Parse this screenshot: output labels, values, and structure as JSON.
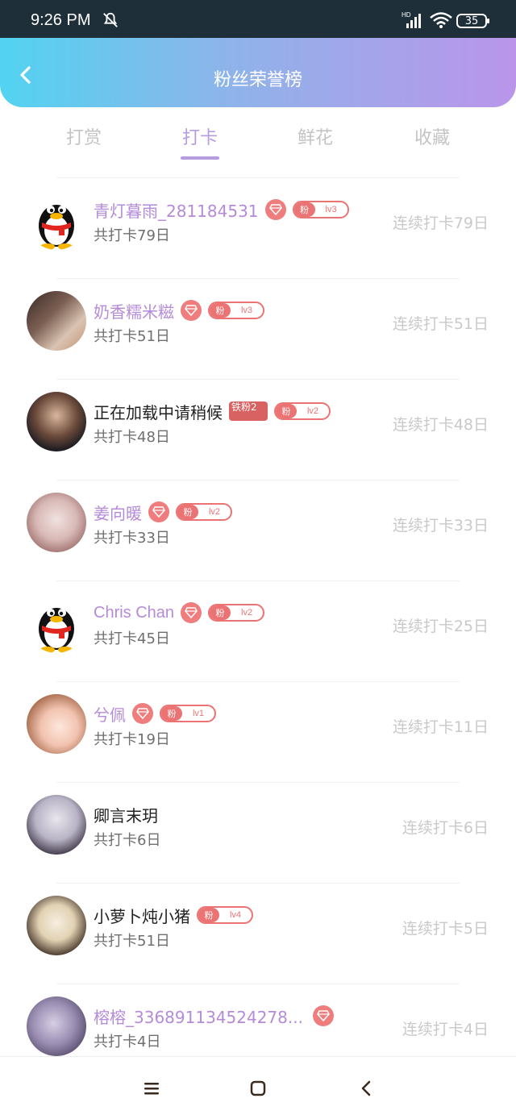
{
  "status": {
    "time": "9:26 PM",
    "battery": "35"
  },
  "header": {
    "title": "粉丝荣誉榜"
  },
  "tabs": [
    {
      "label": "打赏",
      "active": false
    },
    {
      "label": "打卡",
      "active": true
    },
    {
      "label": "鲜花",
      "active": false
    },
    {
      "label": "收藏",
      "active": false
    }
  ],
  "rows": [
    {
      "name": "青灯暮雨_281184531",
      "name_color": "purple",
      "gem": true,
      "fan_label": "粉",
      "level": "lv3",
      "total": "共打卡79日",
      "streak": "连续打卡79日",
      "avatar": "qq-penguin"
    },
    {
      "name": "奶香糯米糍",
      "name_color": "purple",
      "gem": true,
      "fan_label": "粉",
      "level": "lv3",
      "total": "共打卡51日",
      "streak": "连续打卡51日",
      "avatar": "photo"
    },
    {
      "name": "正在加载中请稍候",
      "name_color": "dark",
      "iron_label": "铁粉2",
      "fan_label": "粉",
      "level": "lv2",
      "total": "共打卡48日",
      "streak": "连续打卡48日",
      "avatar": "anime"
    },
    {
      "name": "姜向暖",
      "name_color": "purple",
      "gem": true,
      "fan_label": "粉",
      "level": "lv2",
      "total": "共打卡33日",
      "streak": "连续打卡33日",
      "avatar": "photo"
    },
    {
      "name": "Chris Chan",
      "name_color": "purple",
      "gem": true,
      "fan_label": "粉",
      "level": "lv2",
      "total": "共打卡45日",
      "streak": "连续打卡25日",
      "avatar": "qq-penguin"
    },
    {
      "name": "兮佩",
      "name_color": "purple",
      "gem": true,
      "fan_label": "粉",
      "level": "lv1",
      "total": "共打卡19日",
      "streak": "连续打卡11日",
      "avatar": "anime"
    },
    {
      "name": "卿言末玥",
      "name_color": "dark",
      "total": "共打卡6日",
      "streak": "连续打卡6日",
      "avatar": "photo"
    },
    {
      "name": "小萝卜炖小猪",
      "name_color": "dark",
      "fan_label": "粉",
      "level": "lv4",
      "total": "共打卡51日",
      "streak": "连续打卡5日",
      "avatar": "photo"
    },
    {
      "name": "榕榕_336891134524278...",
      "name_color": "purple",
      "gem": true,
      "total": "共打卡4日",
      "streak": "连续打卡4日",
      "avatar": "photo"
    }
  ],
  "colors": {
    "accent": "#b79be0",
    "badge": "#ec7373",
    "header_start": "#52d3f1",
    "header_end": "#ba95ea"
  },
  "icons": {
    "back": "chevron-left-icon",
    "gem": "diamond-icon",
    "nav_menu": "menu-icon",
    "nav_home": "home-square-icon",
    "nav_back": "back-icon"
  }
}
